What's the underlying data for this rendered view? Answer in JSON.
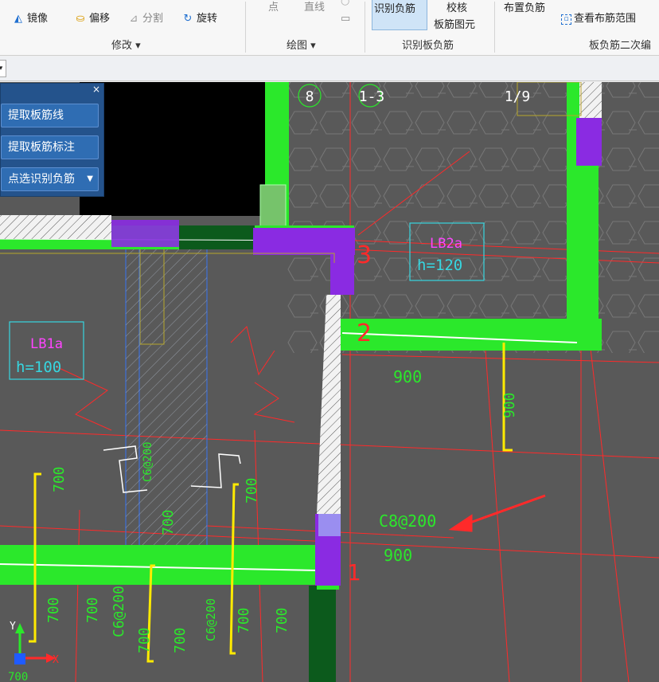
{
  "ribbon": {
    "modify_group": {
      "label": "修改 ▾",
      "items": [
        {
          "label": "镜像",
          "icon": "mirror-icon"
        },
        {
          "label": "偏移",
          "icon": "offset-icon"
        },
        {
          "label": "分割",
          "icon": "split-icon"
        },
        {
          "label": "旋转",
          "icon": "rotate-icon"
        }
      ]
    },
    "draw_group": {
      "label": "绘图 ▾",
      "items": [
        {
          "label": "点"
        },
        {
          "label": "直线"
        }
      ]
    },
    "identify_group": {
      "label": "识别板负筋",
      "primary": "识别负筋",
      "check_top": "校核",
      "check_bottom": "板筋图元"
    },
    "secondary_group": {
      "label": "板负筋二次编",
      "place": "布置负筋",
      "view_range": "查看布筋范围"
    }
  },
  "panel": {
    "close": "×",
    "buttons": [
      "提取板筋线",
      "提取板筋标注",
      "点选识别负筋"
    ]
  },
  "drawing": {
    "axis_bubbles": [
      "8",
      "1-3",
      "1/9"
    ],
    "slab_tags": [
      {
        "name": "LB2a",
        "thickness": "h=120"
      },
      {
        "name": "LB1a",
        "thickness": "h=100"
      }
    ],
    "rebar_labels": [
      "C8@200",
      "C6@200",
      "C6@200",
      "C6@200"
    ],
    "dims": [
      "900",
      "900",
      "900",
      "700",
      "700",
      "700",
      "700",
      "700",
      "700",
      "700",
      "700",
      "700"
    ],
    "handwritten": [
      "3",
      "2",
      "1"
    ],
    "ucs": {
      "y": "Y",
      "x": "X"
    },
    "bottom_text": "700"
  },
  "colors": {
    "canvas": "#595959",
    "wall_green": "#2be82b",
    "column_purple": "#8a2be2",
    "rebar_yellow": "#ffea00",
    "dim_red": "#ff2a2a",
    "slab_cyan": "#36d6e0",
    "slab_magenta": "#ff44ff"
  }
}
